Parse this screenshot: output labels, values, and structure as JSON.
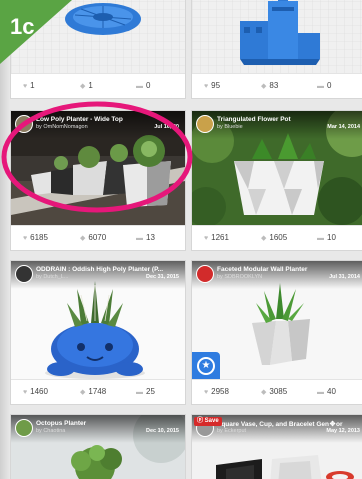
{
  "badge": {
    "label": "1c",
    "color": "#5aa444"
  },
  "highlight_color": "#e6177a",
  "cards": [
    {
      "stats": {
        "likes": "1",
        "views": "1",
        "comments": "0"
      }
    },
    {
      "stats": {
        "likes": "95",
        "views": "83",
        "comments": "0"
      }
    },
    {
      "title": "Low Poly Planter - Wide Top",
      "by": "by OmNomNomagon",
      "date": "Jul 16, 20",
      "stats": {
        "likes": "6185",
        "views": "6070",
        "comments": "13"
      }
    },
    {
      "title": "Triangulated Flower Pot",
      "by": "by Bluebie",
      "date": "Mar 14, 2014",
      "stats": {
        "likes": "1261",
        "views": "1605",
        "comments": "10"
      }
    },
    {
      "title": "ODDRAIN : Oddish High Poly Planter (P...",
      "by": "by Dutch_L...",
      "date": "Dec 31, 2015",
      "stats": {
        "likes": "1460",
        "views": "1748",
        "comments": "25"
      }
    },
    {
      "title": "Faceted Modular Wall Planter",
      "by": "by SDBROOKLYN",
      "date": "Jul 31, 2014",
      "stats": {
        "likes": "2958",
        "views": "3085",
        "comments": "40"
      }
    },
    {
      "title": "Octopus Planter",
      "by": "by Chaotina",
      "date": "Dec 10, 2015"
    },
    {
      "title": "Square Vase, Cup, and Bracelet Gen",
      "title_tail": "or",
      "by": "by Eckerput",
      "date": "May 12, 2013",
      "save_label": "Save"
    }
  ],
  "icons": {
    "like": "heart-icon",
    "view": "download-icon",
    "comment": "comment-icon",
    "star": "star-icon",
    "move": "move-arrows-icon"
  }
}
